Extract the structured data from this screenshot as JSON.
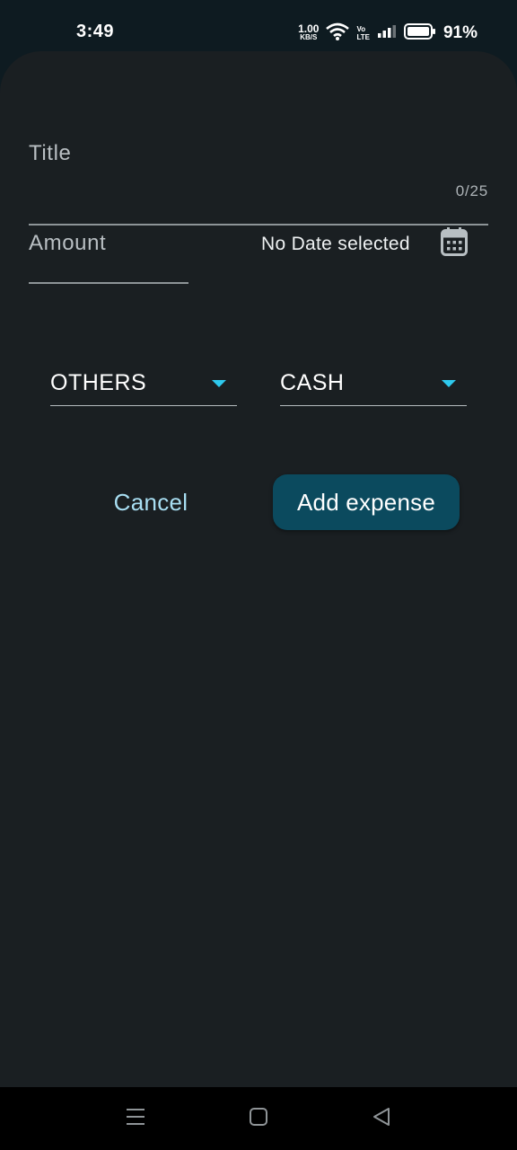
{
  "status_bar": {
    "time": "3:49",
    "net_speed_value": "1.00",
    "net_speed_unit": "KB/S",
    "volte_top": "Vo",
    "volte_bottom": "LTE",
    "battery_percent": "91%",
    "icons": [
      "wifi-icon",
      "signal-icon",
      "battery-icon"
    ]
  },
  "form": {
    "title_placeholder": "Title",
    "title_counter": "0/25",
    "amount_placeholder": "Amount",
    "date_label": "No Date selected",
    "category_value": "OTHERS",
    "payment_value": "CASH",
    "cancel_label": "Cancel",
    "submit_label": "Add expense"
  },
  "colors": {
    "sheet_background": "#1a1f22",
    "accent": "#2ec9ee",
    "primary_button": "#0b4a5e",
    "text_button": "#a8def2"
  },
  "nav_bar": {
    "icons": [
      "menu-icon",
      "home-icon",
      "back-icon"
    ]
  }
}
